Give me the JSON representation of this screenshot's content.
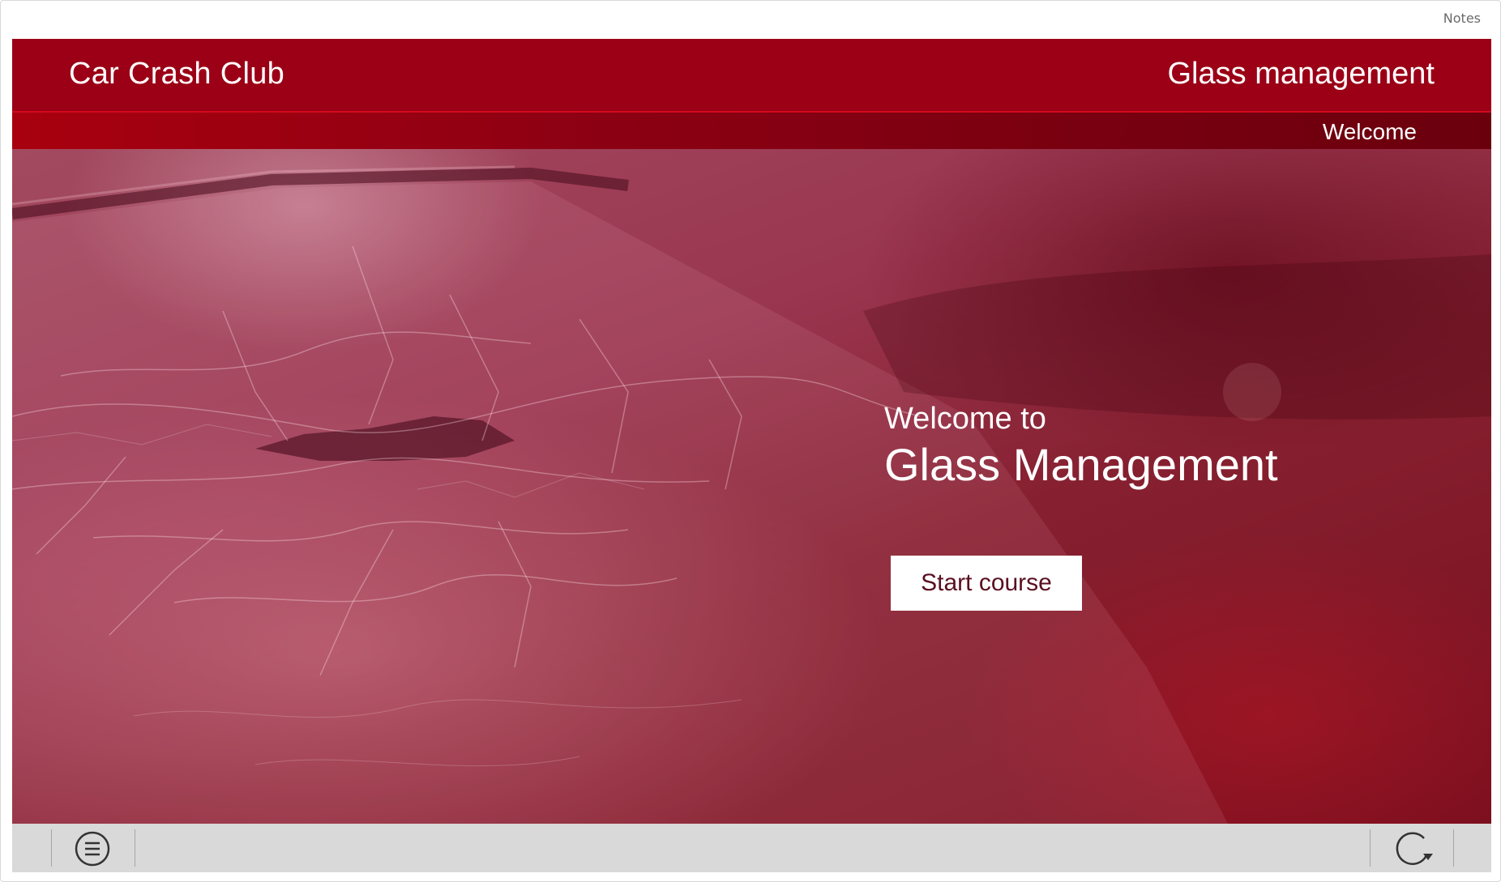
{
  "notes_label": "Notes",
  "header": {
    "brand": "Car Crash Club",
    "course_title": "Glass management"
  },
  "subheader": {
    "section": "Welcome"
  },
  "hero": {
    "welcome_line": "Welcome to",
    "title": "Glass Management",
    "start_button": "Start course"
  },
  "toolbar": {
    "menu_icon": "menu-icon",
    "replay_icon": "replay-icon"
  },
  "colors": {
    "header_red": "#9b0016",
    "accent_red": "#d10a1d",
    "toolbar_gray": "#d9d9d9",
    "button_text": "#5a1020"
  }
}
